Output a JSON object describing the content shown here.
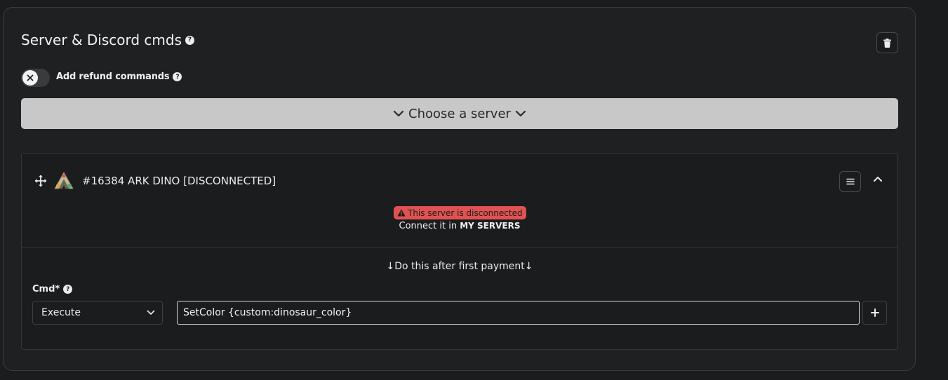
{
  "section": {
    "title": "Server & Discord cmds",
    "title_help_icon": "question-circle-icon",
    "delete_icon": "trash-icon"
  },
  "refund_toggle": {
    "label": "Add refund commands",
    "state": "off",
    "help_icon": "question-circle-icon"
  },
  "server_select": {
    "label": "Choose a server",
    "icons": [
      "chevron-down-icon",
      "chevron-down-icon"
    ]
  },
  "server_card": {
    "name": "#16384 ARK DINO [DISCONNECTED]",
    "drag_icon": "move-icon",
    "game_icon": "ark-logo-icon",
    "menu_icon": "hamburger-icon",
    "collapse_icon": "chevron-up-icon",
    "status_badge": "This server is disconnected",
    "connect_prefix": "Connect it in",
    "connect_link": "MY SERVERS",
    "trigger_label": "Do this after first payment",
    "cmd_label": "Cmd*",
    "cmd_type": "Execute",
    "cmd_value": "SetColor {custom:dinosaur_color}",
    "add_icon": "plus-icon"
  },
  "colors": {
    "badge": "#e05252",
    "select_bar": "#c8c8c8",
    "panel": "#1f2022",
    "background": "#1b1c1e"
  }
}
